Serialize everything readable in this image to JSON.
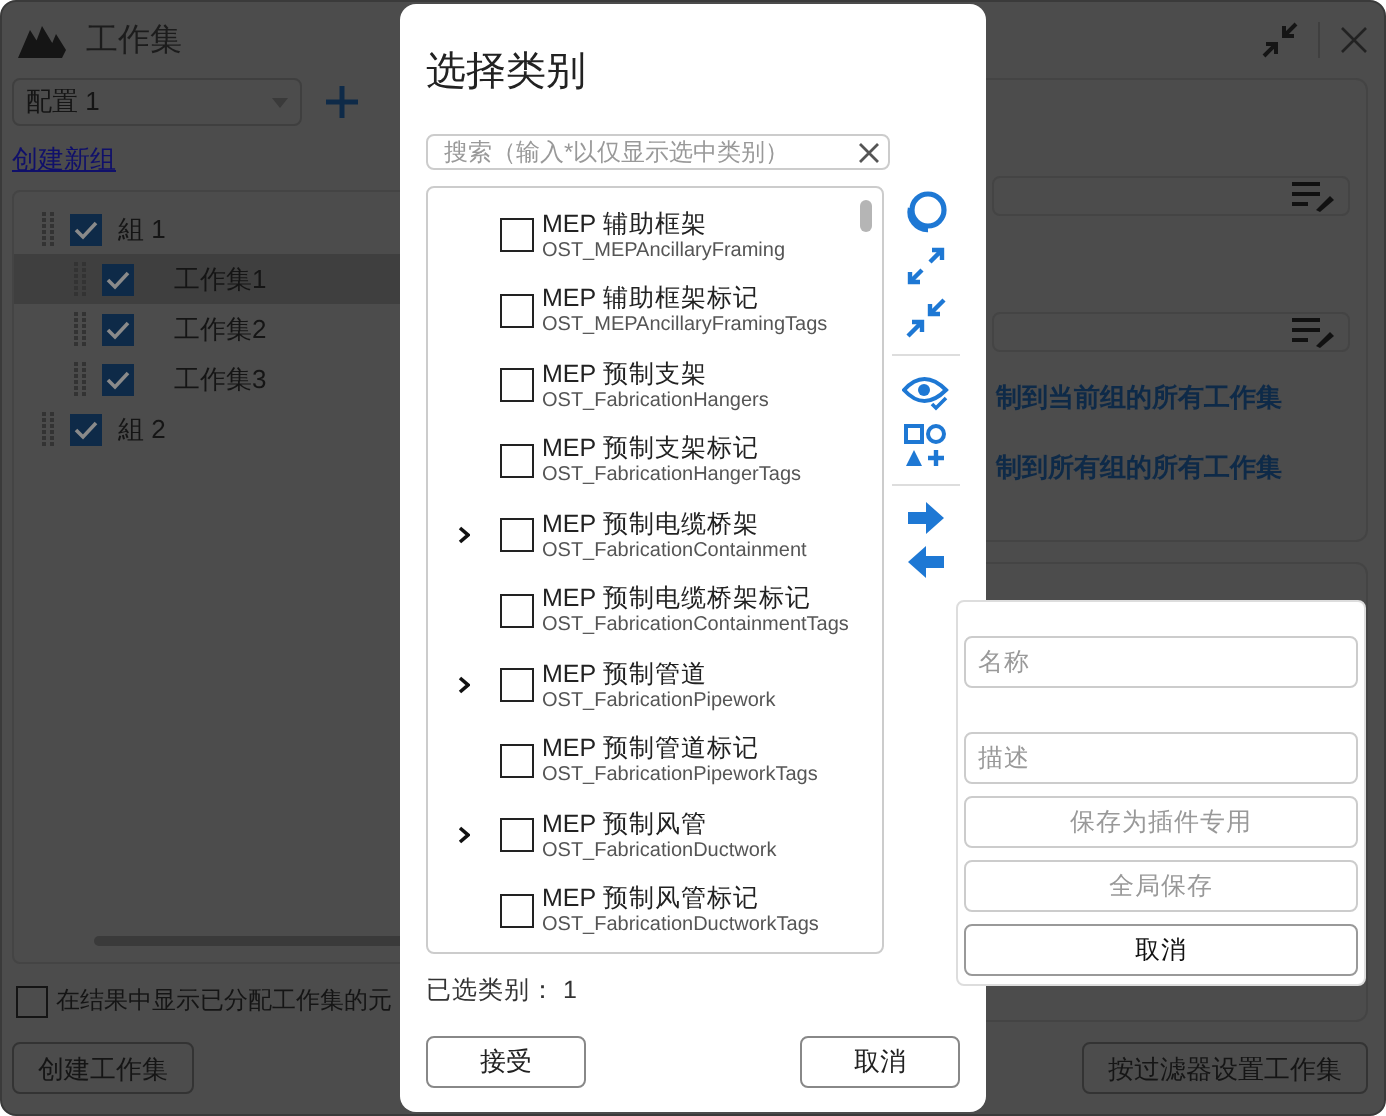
{
  "window": {
    "title": "工作集"
  },
  "config_select": {
    "value": "配置 1"
  },
  "create_group_link": "创建新组",
  "tree": [
    {
      "label": "組 1",
      "checked": true,
      "selected": false,
      "children": [
        {
          "label": "工作集1",
          "checked": true,
          "selected": true
        },
        {
          "label": "工作集2",
          "checked": true,
          "selected": false
        },
        {
          "label": "工作集3",
          "checked": true,
          "selected": false
        }
      ]
    },
    {
      "label": "組 2",
      "checked": true,
      "selected": false
    }
  ],
  "show_assigned": {
    "label": "在结果中显示已分配工作集的元",
    "checked": false
  },
  "create_workset_button": "创建工作集",
  "copy_links": [
    "制到当前组的所有工作集",
    "制到所有组的所有工作集"
  ],
  "filter_button": "按过滤器设置工作集",
  "dialog": {
    "title": "选择类别",
    "search_placeholder": "搜索（输入*以仅显示选中类别）",
    "categories": [
      {
        "name": "MEP 辅助框架",
        "code": "OST_MEPAncillaryFraming",
        "checked": false,
        "expandable": false
      },
      {
        "name": "MEP 辅助框架标记",
        "code": "OST_MEPAncillaryFramingTags",
        "checked": false,
        "expandable": false
      },
      {
        "name": "MEP 预制支架",
        "code": "OST_FabricationHangers",
        "checked": false,
        "expandable": false
      },
      {
        "name": "MEP 预制支架标记",
        "code": "OST_FabricationHangerTags",
        "checked": false,
        "expandable": false
      },
      {
        "name": "MEP 预制电缆桥架",
        "code": "OST_FabricationContainment",
        "checked": false,
        "expandable": true
      },
      {
        "name": "MEP 预制电缆桥架标记",
        "code": "OST_FabricationContainmentTags",
        "checked": false,
        "expandable": false
      },
      {
        "name": "MEP 预制管道",
        "code": "OST_FabricationPipework",
        "checked": false,
        "expandable": true
      },
      {
        "name": "MEP 预制管道标记",
        "code": "OST_FabricationPipeworkTags",
        "checked": false,
        "expandable": false
      },
      {
        "name": "MEP 预制风管",
        "code": "OST_FabricationDuctwork",
        "checked": false,
        "expandable": true
      },
      {
        "name": "MEP 预制风管标记",
        "code": "OST_FabricationDuctworkTags",
        "checked": false,
        "expandable": false
      }
    ],
    "selected_count": "已选类别： 1",
    "accept_button": "接受",
    "cancel_button": "取消"
  },
  "save_popup": {
    "name_placeholder": "名称",
    "description_placeholder": "描述",
    "buttons": [
      {
        "label": "保存为插件专用",
        "disabled": true
      },
      {
        "label": "全局保存",
        "disabled": true
      },
      {
        "label": "取消",
        "disabled": false
      }
    ]
  }
}
